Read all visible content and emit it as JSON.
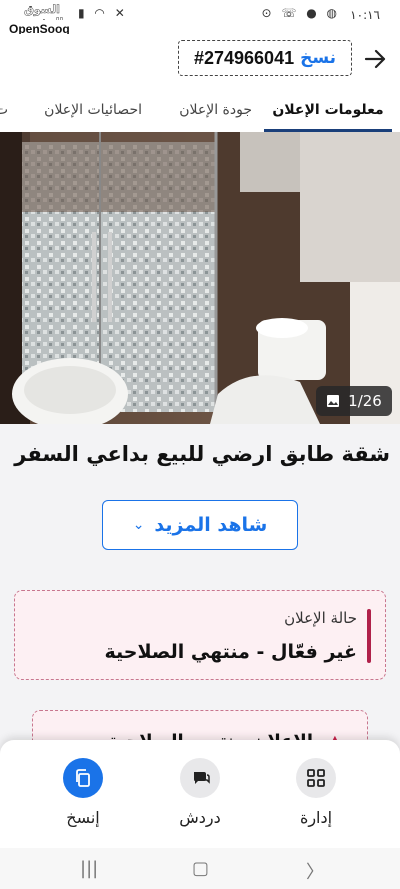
{
  "statusbar": {
    "time": "١٠:١٦",
    "watermark": "السوق المفتوح",
    "brand": "OpenSooq"
  },
  "header": {
    "ad_id": "#274966041",
    "copy_label": "نسخ"
  },
  "tabs": [
    {
      "label": "معلومات الإعلان",
      "active": true
    },
    {
      "label": "جودة الإعلان",
      "active": false
    },
    {
      "label": "احصائيات الإعلان",
      "active": false
    },
    {
      "label": "ت",
      "active": false
    }
  ],
  "gallery": {
    "counter": "1/26"
  },
  "listing": {
    "title": "شقة طابق ارضي للبيع بداعي السفر",
    "more_label": "شاهد المزيد"
  },
  "status_card": {
    "label": "حالة الإعلان",
    "value": "غير فعّال - منتهي الصلاحية"
  },
  "warning_card": {
    "text": "الإعلان منتهي الصلاحية"
  },
  "bottom_nav": {
    "manage": "إدارة",
    "chat": "دردش",
    "copy": "إنسخ"
  },
  "colors": {
    "accent": "#1a73e8",
    "tab_indicator": "#1a3f7a",
    "alert": "#b0214a"
  }
}
